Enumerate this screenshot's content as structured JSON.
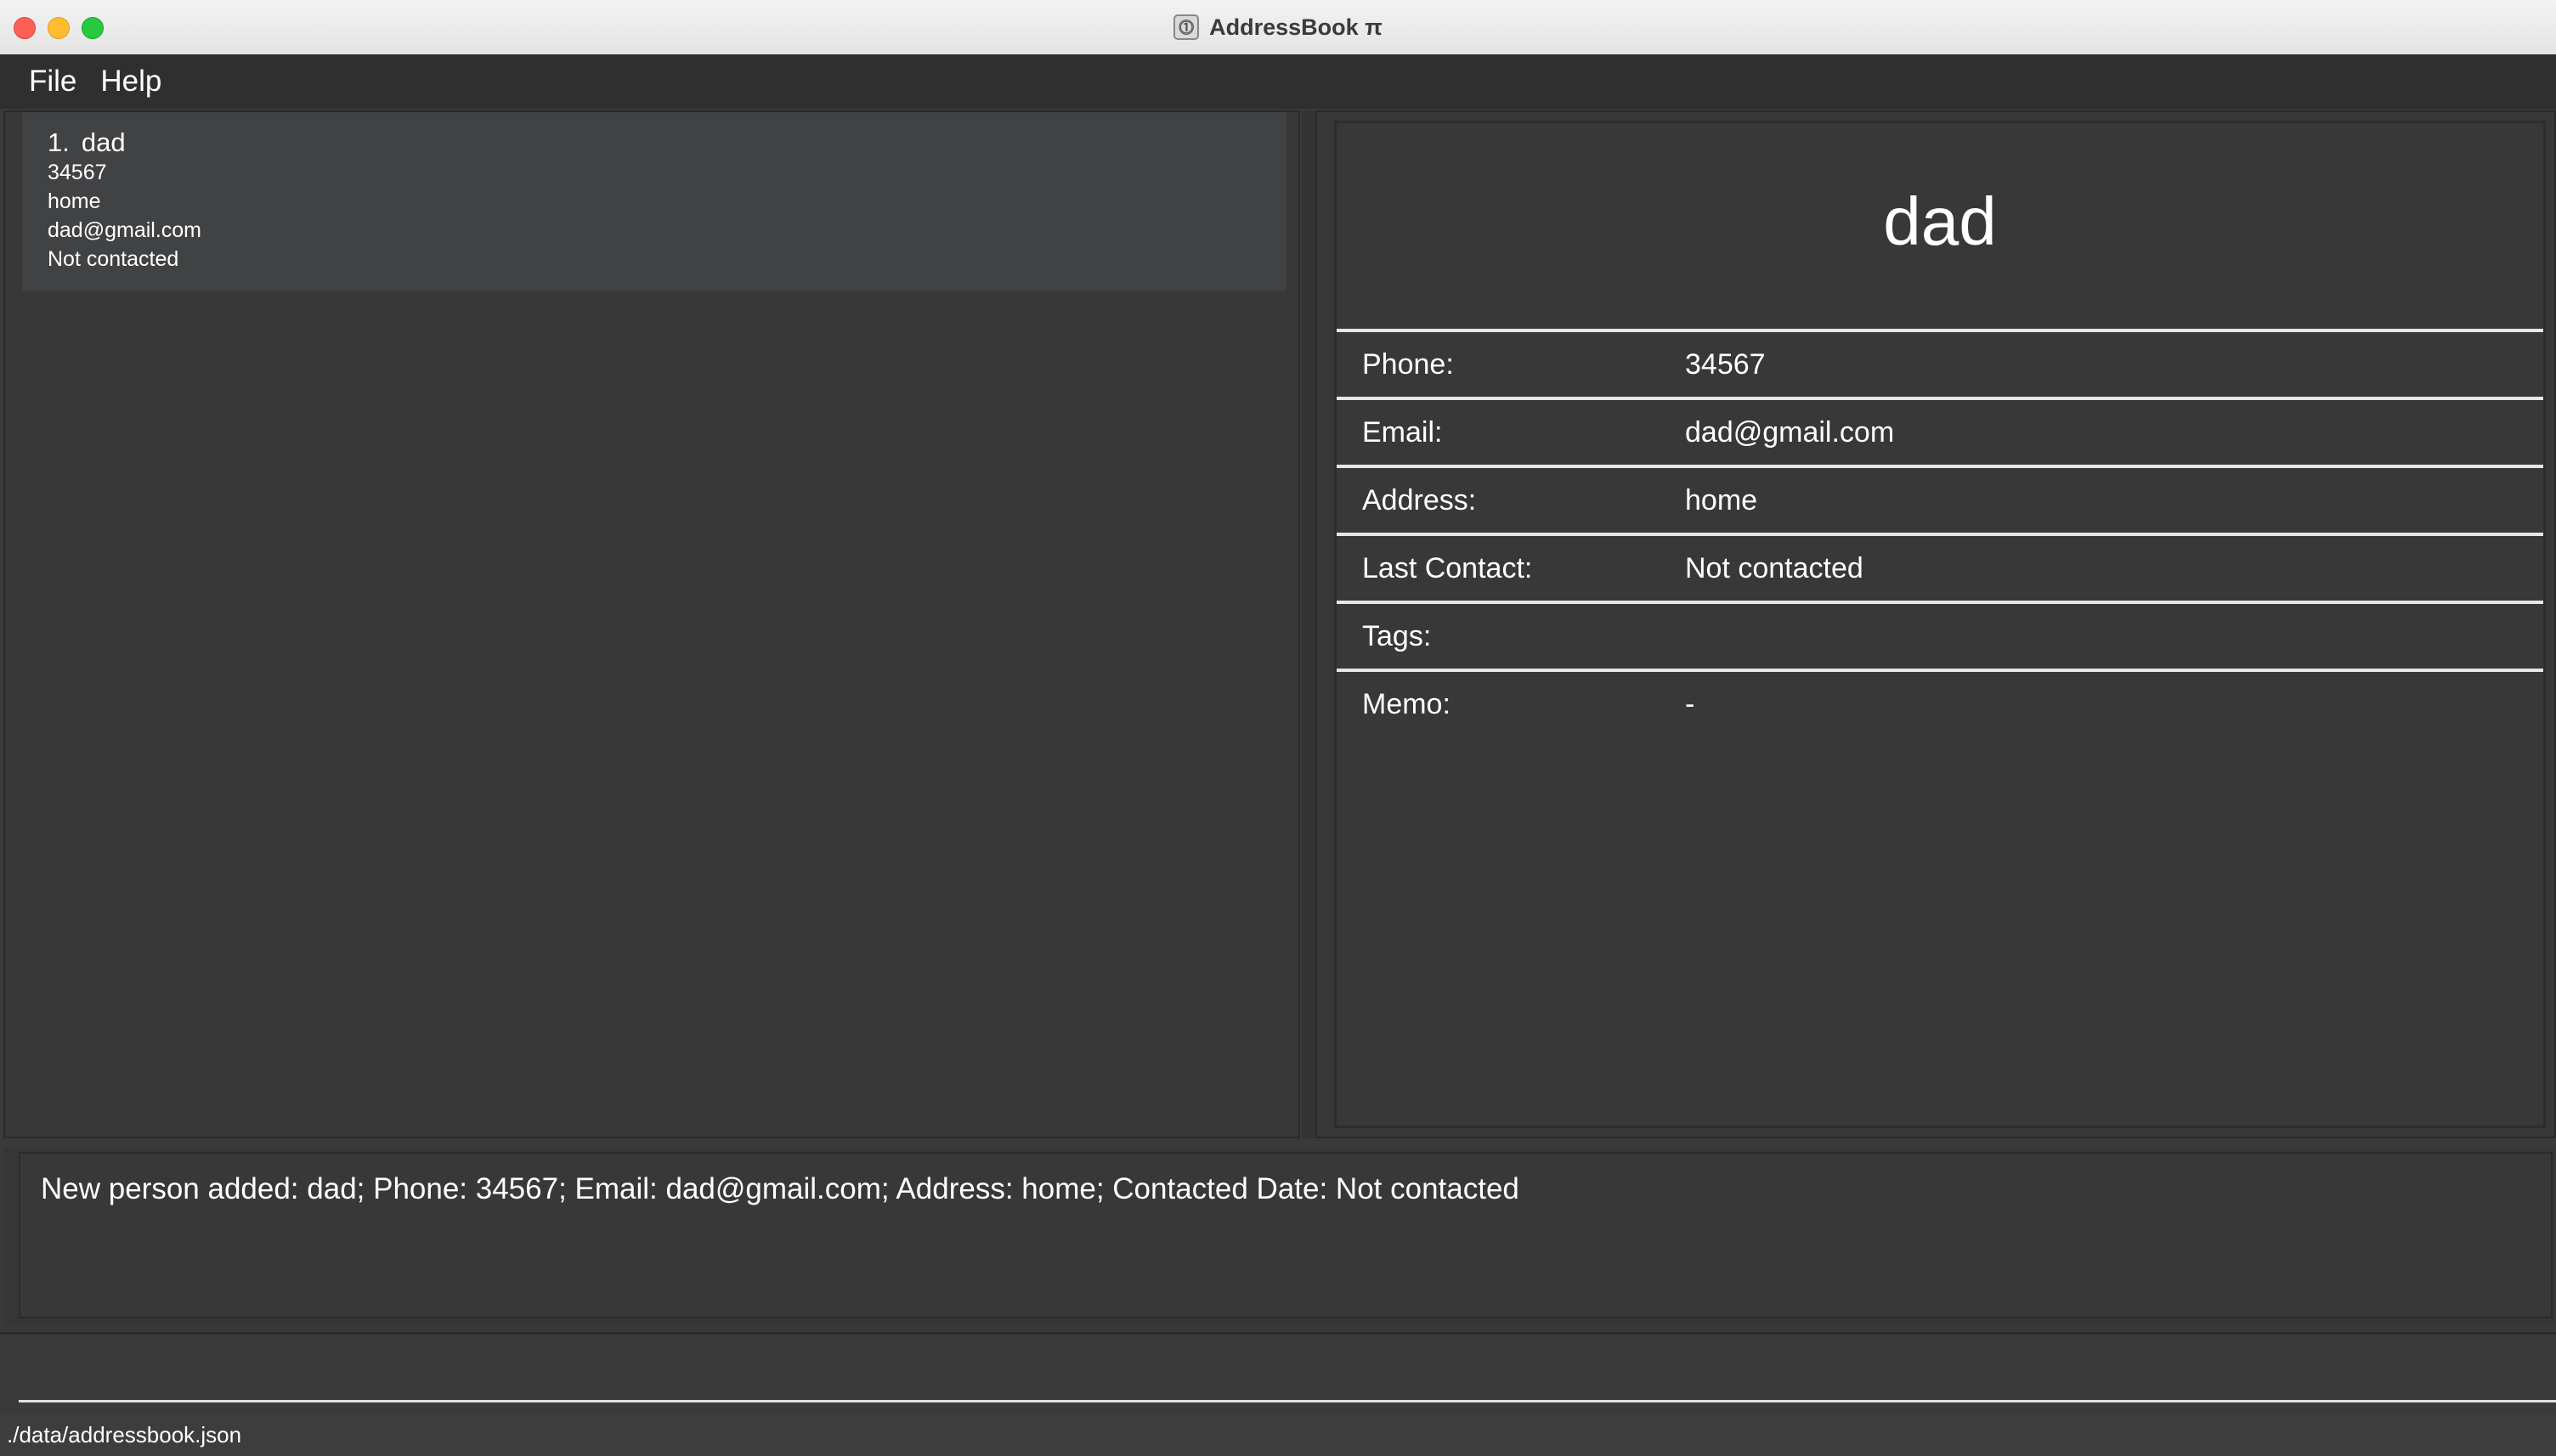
{
  "window": {
    "title": "AddressBook π",
    "app_icon_glyph": "⓵"
  },
  "menu": {
    "items": [
      {
        "label": "File"
      },
      {
        "label": "Help"
      }
    ]
  },
  "person_list": [
    {
      "index": "1.",
      "name": "dad",
      "phone": "34567",
      "address": "home",
      "email": "dad@gmail.com",
      "contact_status": "Not contacted"
    }
  ],
  "detail": {
    "name": "dad",
    "rows": [
      {
        "label": "Phone:",
        "value": "34567"
      },
      {
        "label": "Email:",
        "value": "dad@gmail.com"
      },
      {
        "label": "Address:",
        "value": "home"
      },
      {
        "label": "Last Contact:",
        "value": "Not contacted"
      },
      {
        "label": "Tags:",
        "value": ""
      },
      {
        "label": "Memo:",
        "value": "-"
      }
    ]
  },
  "result": {
    "message": "New person added: dad; Phone: 34567; Email: dad@gmail.com; Address: home; Contacted Date: Not contacted"
  },
  "command": {
    "value": ""
  },
  "status": {
    "save_location": "./data/addressbook.json"
  },
  "colors": {
    "background": "#3a3a3a",
    "card": "#414244",
    "text": "#ffffff"
  }
}
